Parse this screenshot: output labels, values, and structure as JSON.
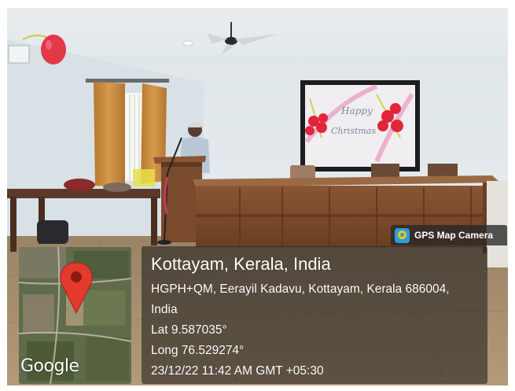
{
  "stamp": {
    "app_badge": "GPS Map Camera",
    "place": "Kottayam, Kerala, India",
    "address_line1": "HGPH+QM, Eerayil Kadavu, Kottayam, Kerala 686004,",
    "address_line2": "India",
    "latitude": "Lat 9.587035°",
    "longitude": "Long 76.529274°",
    "timestamp": "23/12/22 11:42 AM GMT +05:30",
    "map_logo": "Google"
  },
  "scene": {
    "description_icons": [
      "balloon",
      "ceiling-fan",
      "ceiling-light",
      "curtain",
      "window",
      "podium",
      "speaker",
      "microphone",
      "table",
      "notice-board",
      "chair"
    ],
    "colors": {
      "wall": "#e4eaee",
      "floor": "#a0896a",
      "wood": "#7a4a2a",
      "curtain": "#c88a3a",
      "balloon": "#e8283a",
      "pin": "#e23a2c"
    }
  }
}
